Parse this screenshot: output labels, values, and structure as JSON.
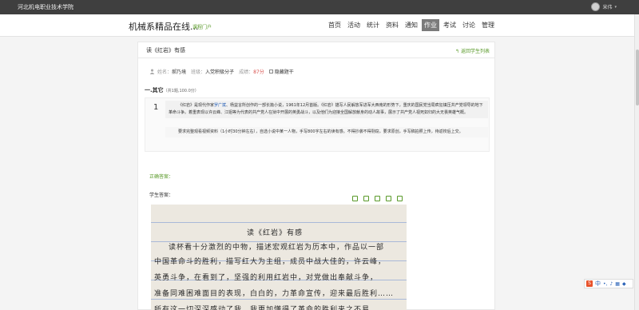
{
  "topbar": {
    "school": "河北机电职业技术学院",
    "username": "宋伟",
    "caret": "▾"
  },
  "header": {
    "course_title": "机械系精品在线...",
    "portal_link": "课程门户",
    "nav": [
      "首页",
      "活动",
      "统计",
      "资料",
      "通知",
      "作业",
      "考试",
      "讨论",
      "管理"
    ],
    "active_nav": "作业"
  },
  "page": {
    "title": "读《红岩》有感",
    "back_link": "返回学生列表"
  },
  "student_info": {
    "name_label": "姓名：",
    "name": "郝乃境",
    "class_label": "班级：",
    "class": "入党积极分子",
    "score_label": "成绩：",
    "score": "87分",
    "hide_label": "隐藏题干"
  },
  "section": {
    "heading": "一.其它",
    "sub": "（共1题,100.0分）"
  },
  "question": {
    "number": "1",
    "para1_a": "《红岩》是现代作家",
    "para1_link": "罗广斌",
    "para1_b": "、杨益言所创作的一部长篇小说，1961年12月首版。《红岩》描写人民解放军进军大西南的形势下，重庆的国民党当局疯狂镇压共产党领导的地下革命斗争。着重表现以许云峰、江姐等为代表的共产党人在狱中开展的英勇战斗，以及他们为迎接全国解放献身的动人故事，展示了共产党人视死如归的大无畏英雄气概。",
    "para2": "要求完整观看视频资料（1小时30分钟左右），自选小说中某一人物，手写800字左右的读有感。不得抄袭不得剽窃，要求原创，手写稿拍照上传，待返校后上交。"
  },
  "labels": {
    "correct_answer": "正确答案：",
    "student_answer": "学生答案："
  },
  "handwriting": {
    "title": "读《红岩》有感",
    "lines": [
      "读杯看十分激烈的中物，描述宏观红岩为历本中，作品以一部",
      "中国革命斗的胜利，描写红大为主组，成员中战大佳的，许云峰，",
      "英勇斗争，在看到了，坚强的利用红岩中，对党做出奉献斗争，",
      "准备同难困难面目的表现，白白的，力革命宣传，迎来最后胜利……",
      "所有这一切深深感动了我，我更加懂得了革命的胜利来之不易……"
    ]
  },
  "ime": {
    "logo": "S",
    "lang": "中"
  },
  "colors": {
    "accent_green": "#5a9a2a",
    "score_red": "#d9534f",
    "link_blue": "#2b63b8",
    "topbar": "#3f3f3f"
  }
}
